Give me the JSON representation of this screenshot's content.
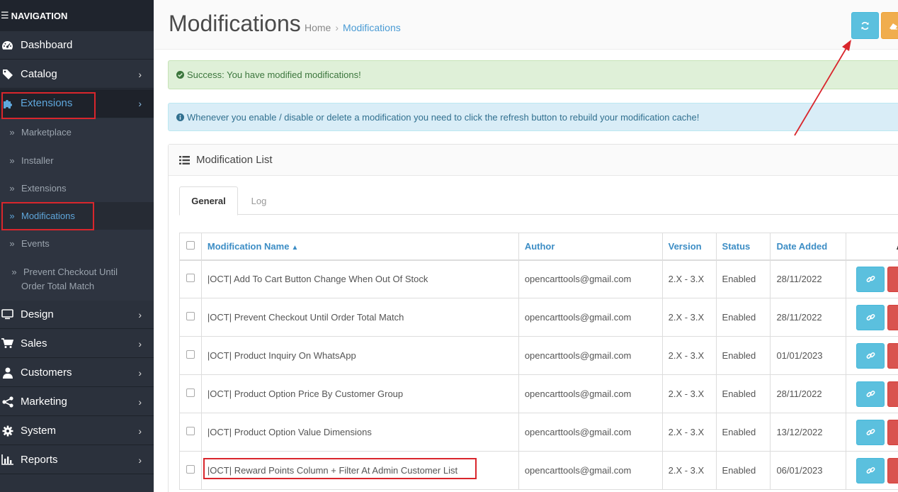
{
  "sidebar": {
    "header": "NAVIGATION",
    "menu": [
      {
        "label": "Dashboard",
        "icon": "dashboard-icon",
        "has_children": false,
        "active": false
      },
      {
        "label": "Catalog",
        "icon": "tag-icon",
        "has_children": true,
        "active": false
      },
      {
        "label": "Extensions",
        "icon": "puzzle-icon",
        "has_children": true,
        "active": true
      },
      {
        "label": "Design",
        "icon": "monitor-icon",
        "has_children": true,
        "active": false
      },
      {
        "label": "Sales",
        "icon": "cart-icon",
        "has_children": true,
        "active": false
      },
      {
        "label": "Customers",
        "icon": "user-icon",
        "has_children": true,
        "active": false
      },
      {
        "label": "Marketing",
        "icon": "share-icon",
        "has_children": true,
        "active": false
      },
      {
        "label": "System",
        "icon": "gear-icon",
        "has_children": true,
        "active": false
      },
      {
        "label": "Reports",
        "icon": "bar-chart-icon",
        "has_children": true,
        "active": false
      }
    ],
    "extensions_submenu": [
      {
        "label": "Marketplace",
        "active": false
      },
      {
        "label": "Installer",
        "active": false
      },
      {
        "label": "Extensions",
        "active": false
      },
      {
        "label": "Modifications",
        "active": true
      },
      {
        "label": "Events",
        "active": false
      },
      {
        "label": "Prevent Checkout Until Order Total Match",
        "active": false
      }
    ]
  },
  "header": {
    "title": "Modifications",
    "breadcrumb": [
      "Home",
      "Modifications"
    ],
    "refresh_button_icon": "refresh-icon",
    "clear_button_icon": "eraser-icon"
  },
  "alerts": {
    "success": "Success: You have modified modifications!",
    "info": "Whenever you enable / disable or delete a modification you need to click the refresh button to rebuild your modification cache!"
  },
  "panel": {
    "title": "Modification List",
    "tabs": [
      "General",
      "Log"
    ],
    "active_tab": "General"
  },
  "table": {
    "columns": [
      "Modification Name",
      "Author",
      "Version",
      "Status",
      "Date Added",
      "A"
    ],
    "sort_column": "Modification Name",
    "sort_dir": "asc",
    "rows": [
      {
        "name": "|OCT| Add To Cart Button Change When Out Of Stock",
        "author": "opencarttools@gmail.com",
        "version": "2.X - 3.X",
        "status": "Enabled",
        "date": "28/11/2022"
      },
      {
        "name": "|OCT| Prevent Checkout Until Order Total Match",
        "author": "opencarttools@gmail.com",
        "version": "2.X - 3.X",
        "status": "Enabled",
        "date": "28/11/2022"
      },
      {
        "name": "|OCT| Product Inquiry On WhatsApp",
        "author": "opencarttools@gmail.com",
        "version": "2.X - 3.X",
        "status": "Enabled",
        "date": "01/01/2023"
      },
      {
        "name": "|OCT| Product Option Price By Customer Group",
        "author": "opencarttools@gmail.com",
        "version": "2.X - 3.X",
        "status": "Enabled",
        "date": "28/11/2022"
      },
      {
        "name": "|OCT| Product Option Value Dimensions",
        "author": "opencarttools@gmail.com",
        "version": "2.X - 3.X",
        "status": "Enabled",
        "date": "13/12/2022"
      },
      {
        "name": "|OCT| Reward Points Column + Filter At Admin Customer List",
        "author": "opencarttools@gmail.com",
        "version": "2.X - 3.X",
        "status": "Enabled",
        "date": "06/01/2023"
      }
    ]
  },
  "colors": {
    "sidebar_bg": "#2b313c",
    "accent_blue": "#4a9bd4",
    "info_button": "#5bc0de",
    "warning_button": "#f0ad4e",
    "danger_button": "#d9534f",
    "annotation_red": "#d9262c"
  }
}
